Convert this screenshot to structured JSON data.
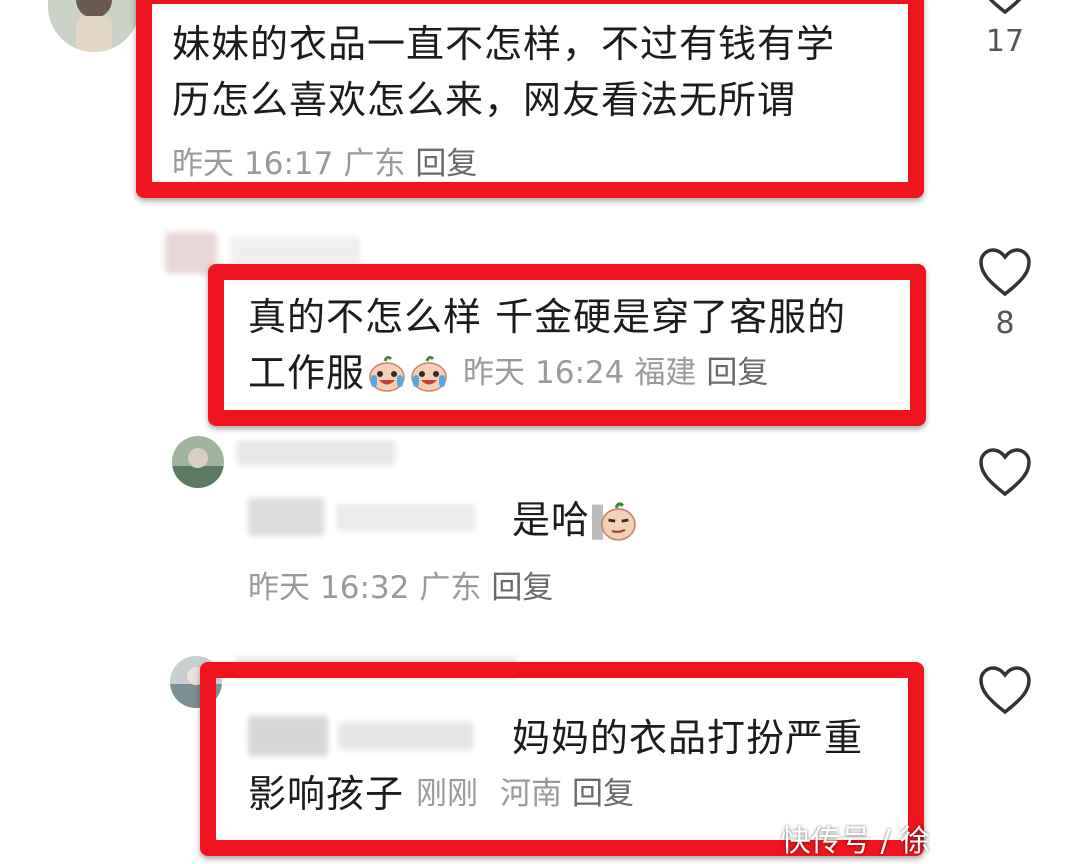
{
  "comments": [
    {
      "text_line1": "妹妹的衣品一直不怎样，不过有钱有学",
      "text_line2": "历怎么喜欢怎么来，网友看法无所谓",
      "date": "昨天",
      "time": "16:17",
      "location": "广东",
      "reply_label": "回复",
      "like_count": "17"
    },
    {
      "text_line1": "真的不怎么样 千金硬是穿了客服的",
      "text_line2": "工作服",
      "date": "昨天",
      "time": "16:24",
      "location": "福建",
      "reply_label": "回复",
      "like_count": "8"
    },
    {
      "text": "是哈",
      "date": "昨天",
      "time": "16:32",
      "location": "广东",
      "reply_label": "回复"
    },
    {
      "text_line1": "妈妈的衣品打扮严重",
      "text_line2": "影响孩子",
      "date": "刚刚",
      "location": "河南",
      "reply_label": "回复"
    }
  ],
  "watermark": "快传号 / 徐",
  "colors": {
    "highlight": "#f0141e",
    "meta_text": "#9a9a9a",
    "body_text": "#1c1c1c"
  }
}
